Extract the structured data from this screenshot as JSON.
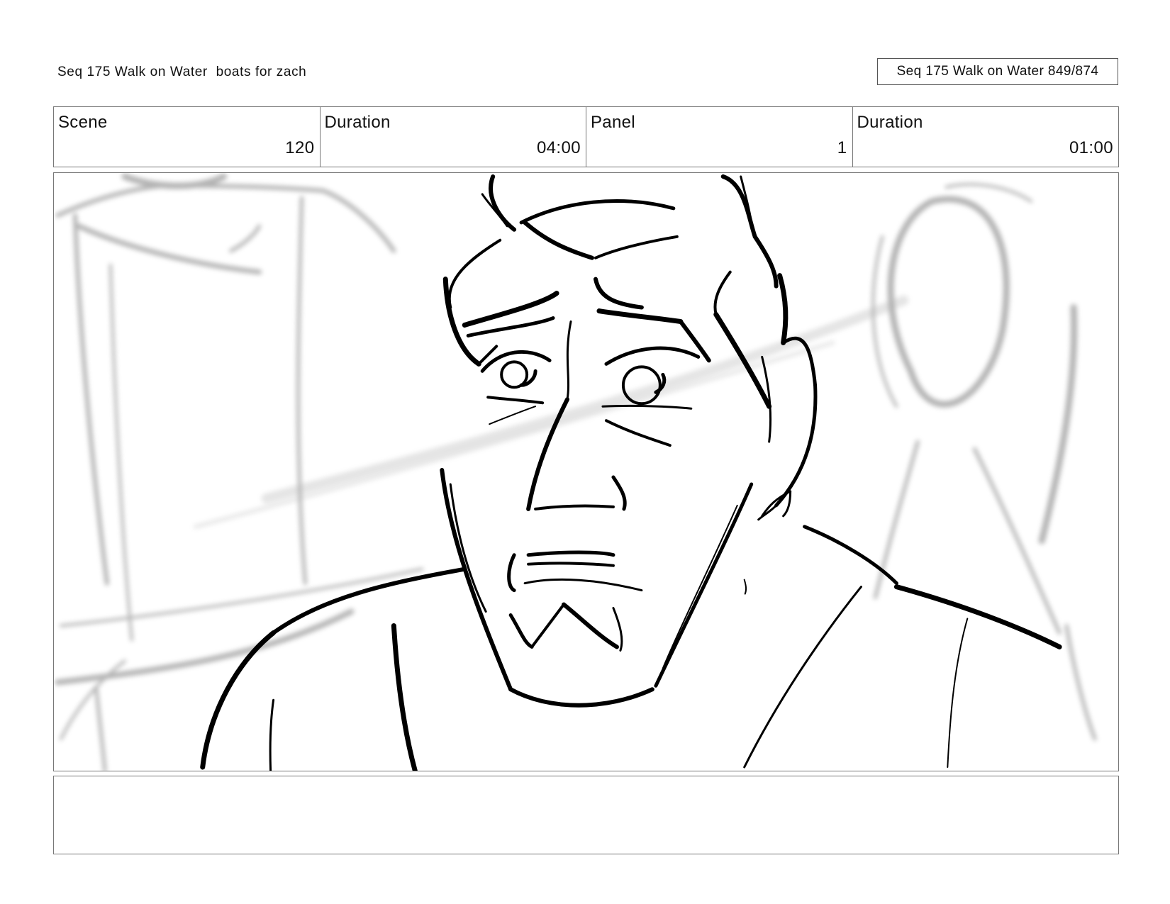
{
  "header": {
    "title": "Seq 175 Walk on Water  boats for zach",
    "page_ref": "Seq 175 Walk on Water 849/874"
  },
  "info": {
    "scene_label": "Scene",
    "scene_value": "120",
    "scene_duration_label": "Duration",
    "scene_duration_value": "04:00",
    "panel_label": "Panel",
    "panel_value": "1",
    "panel_duration_label": "Duration",
    "panel_duration_value": "01:00"
  },
  "panel": {
    "drawing": "storyboard-sketch-icon"
  },
  "notes": {
    "text": ""
  }
}
